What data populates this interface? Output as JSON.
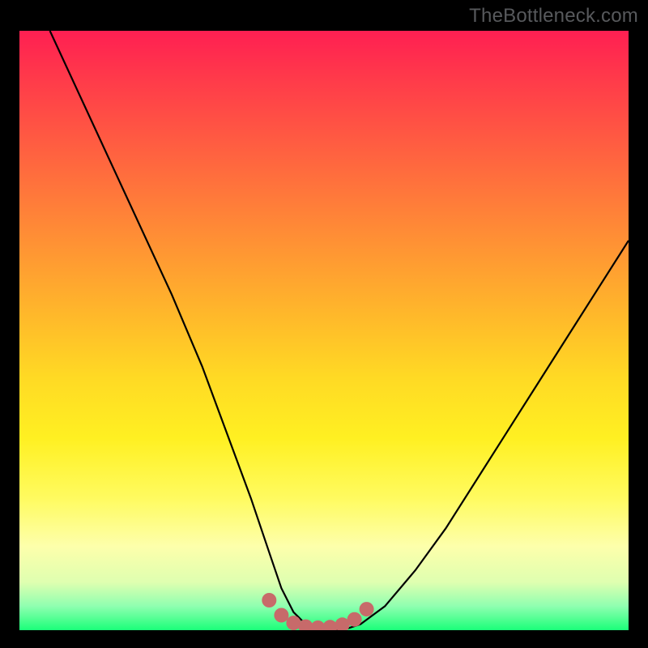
{
  "watermark": "TheBottleneck.com",
  "chart_data": {
    "type": "line",
    "title": "",
    "xlabel": "",
    "ylabel": "",
    "xlim": [
      0,
      100
    ],
    "ylim": [
      0,
      100
    ],
    "grid": false,
    "series": [
      {
        "name": "bottleneck-curve",
        "x": [
          5,
          10,
          15,
          20,
          25,
          30,
          34,
          38,
          41,
          43,
          45,
          47,
          50,
          53,
          56,
          60,
          65,
          70,
          75,
          80,
          85,
          90,
          95,
          100
        ],
        "y": [
          100,
          89,
          78,
          67,
          56,
          44,
          33,
          22,
          13,
          7,
          3,
          1,
          0,
          0,
          1,
          4,
          10,
          17,
          25,
          33,
          41,
          49,
          57,
          65
        ]
      }
    ],
    "dip_markers": {
      "name": "dip-dots",
      "x": [
        41,
        43,
        45,
        47,
        49,
        51,
        53,
        55,
        57
      ],
      "y": [
        5,
        2.5,
        1.2,
        0.6,
        0.4,
        0.5,
        0.9,
        1.8,
        3.5
      ],
      "color": "#c76a6a",
      "size": 18
    },
    "colors": {
      "curve": "#000000",
      "frame": "#000000",
      "gradient_top": "#ff1f52",
      "gradient_mid": "#fff022",
      "gradient_bottom": "#1bff79",
      "watermark": "#57595c"
    }
  }
}
